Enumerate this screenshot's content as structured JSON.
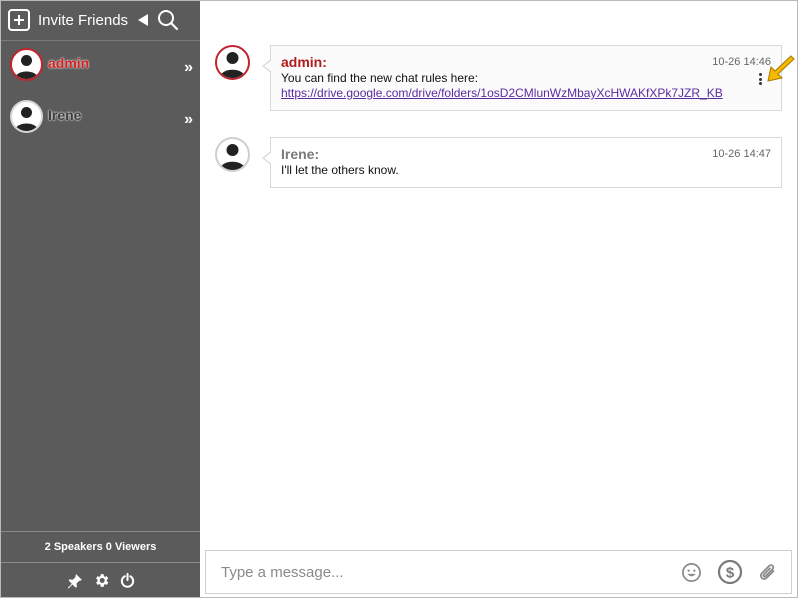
{
  "sidebar": {
    "invite_label": "Invite Friends",
    "users": [
      {
        "name": "admin",
        "role": "admin"
      },
      {
        "name": "Irene",
        "role": "regular"
      }
    ],
    "more_glyph": "»",
    "stats": "2 Speakers 0 Viewers",
    "tools": [
      "pin-icon",
      "gear-icon",
      "power-icon"
    ]
  },
  "messages": [
    {
      "sender": "admin:",
      "time": "10-26 14:46",
      "text": "You can find the new chat rules here:",
      "link": "https://drive.google.com/drive/folders/1osD2CMlunWzMbayXcHWAKfXPk7JZR_KB"
    },
    {
      "sender": "Irene:",
      "time": "10-26 14:47",
      "text": "I'll let the others know."
    }
  ],
  "composer": {
    "placeholder": "Type a message...",
    "icons": [
      "emoji-icon",
      "dollar-icon",
      "paperclip-icon"
    ]
  },
  "colors": {
    "sidebar_bg": "#5b5b5b",
    "admin_name": "#d0201f",
    "link": "#5a2ca0",
    "pointer_arrow": "#f5b800"
  }
}
